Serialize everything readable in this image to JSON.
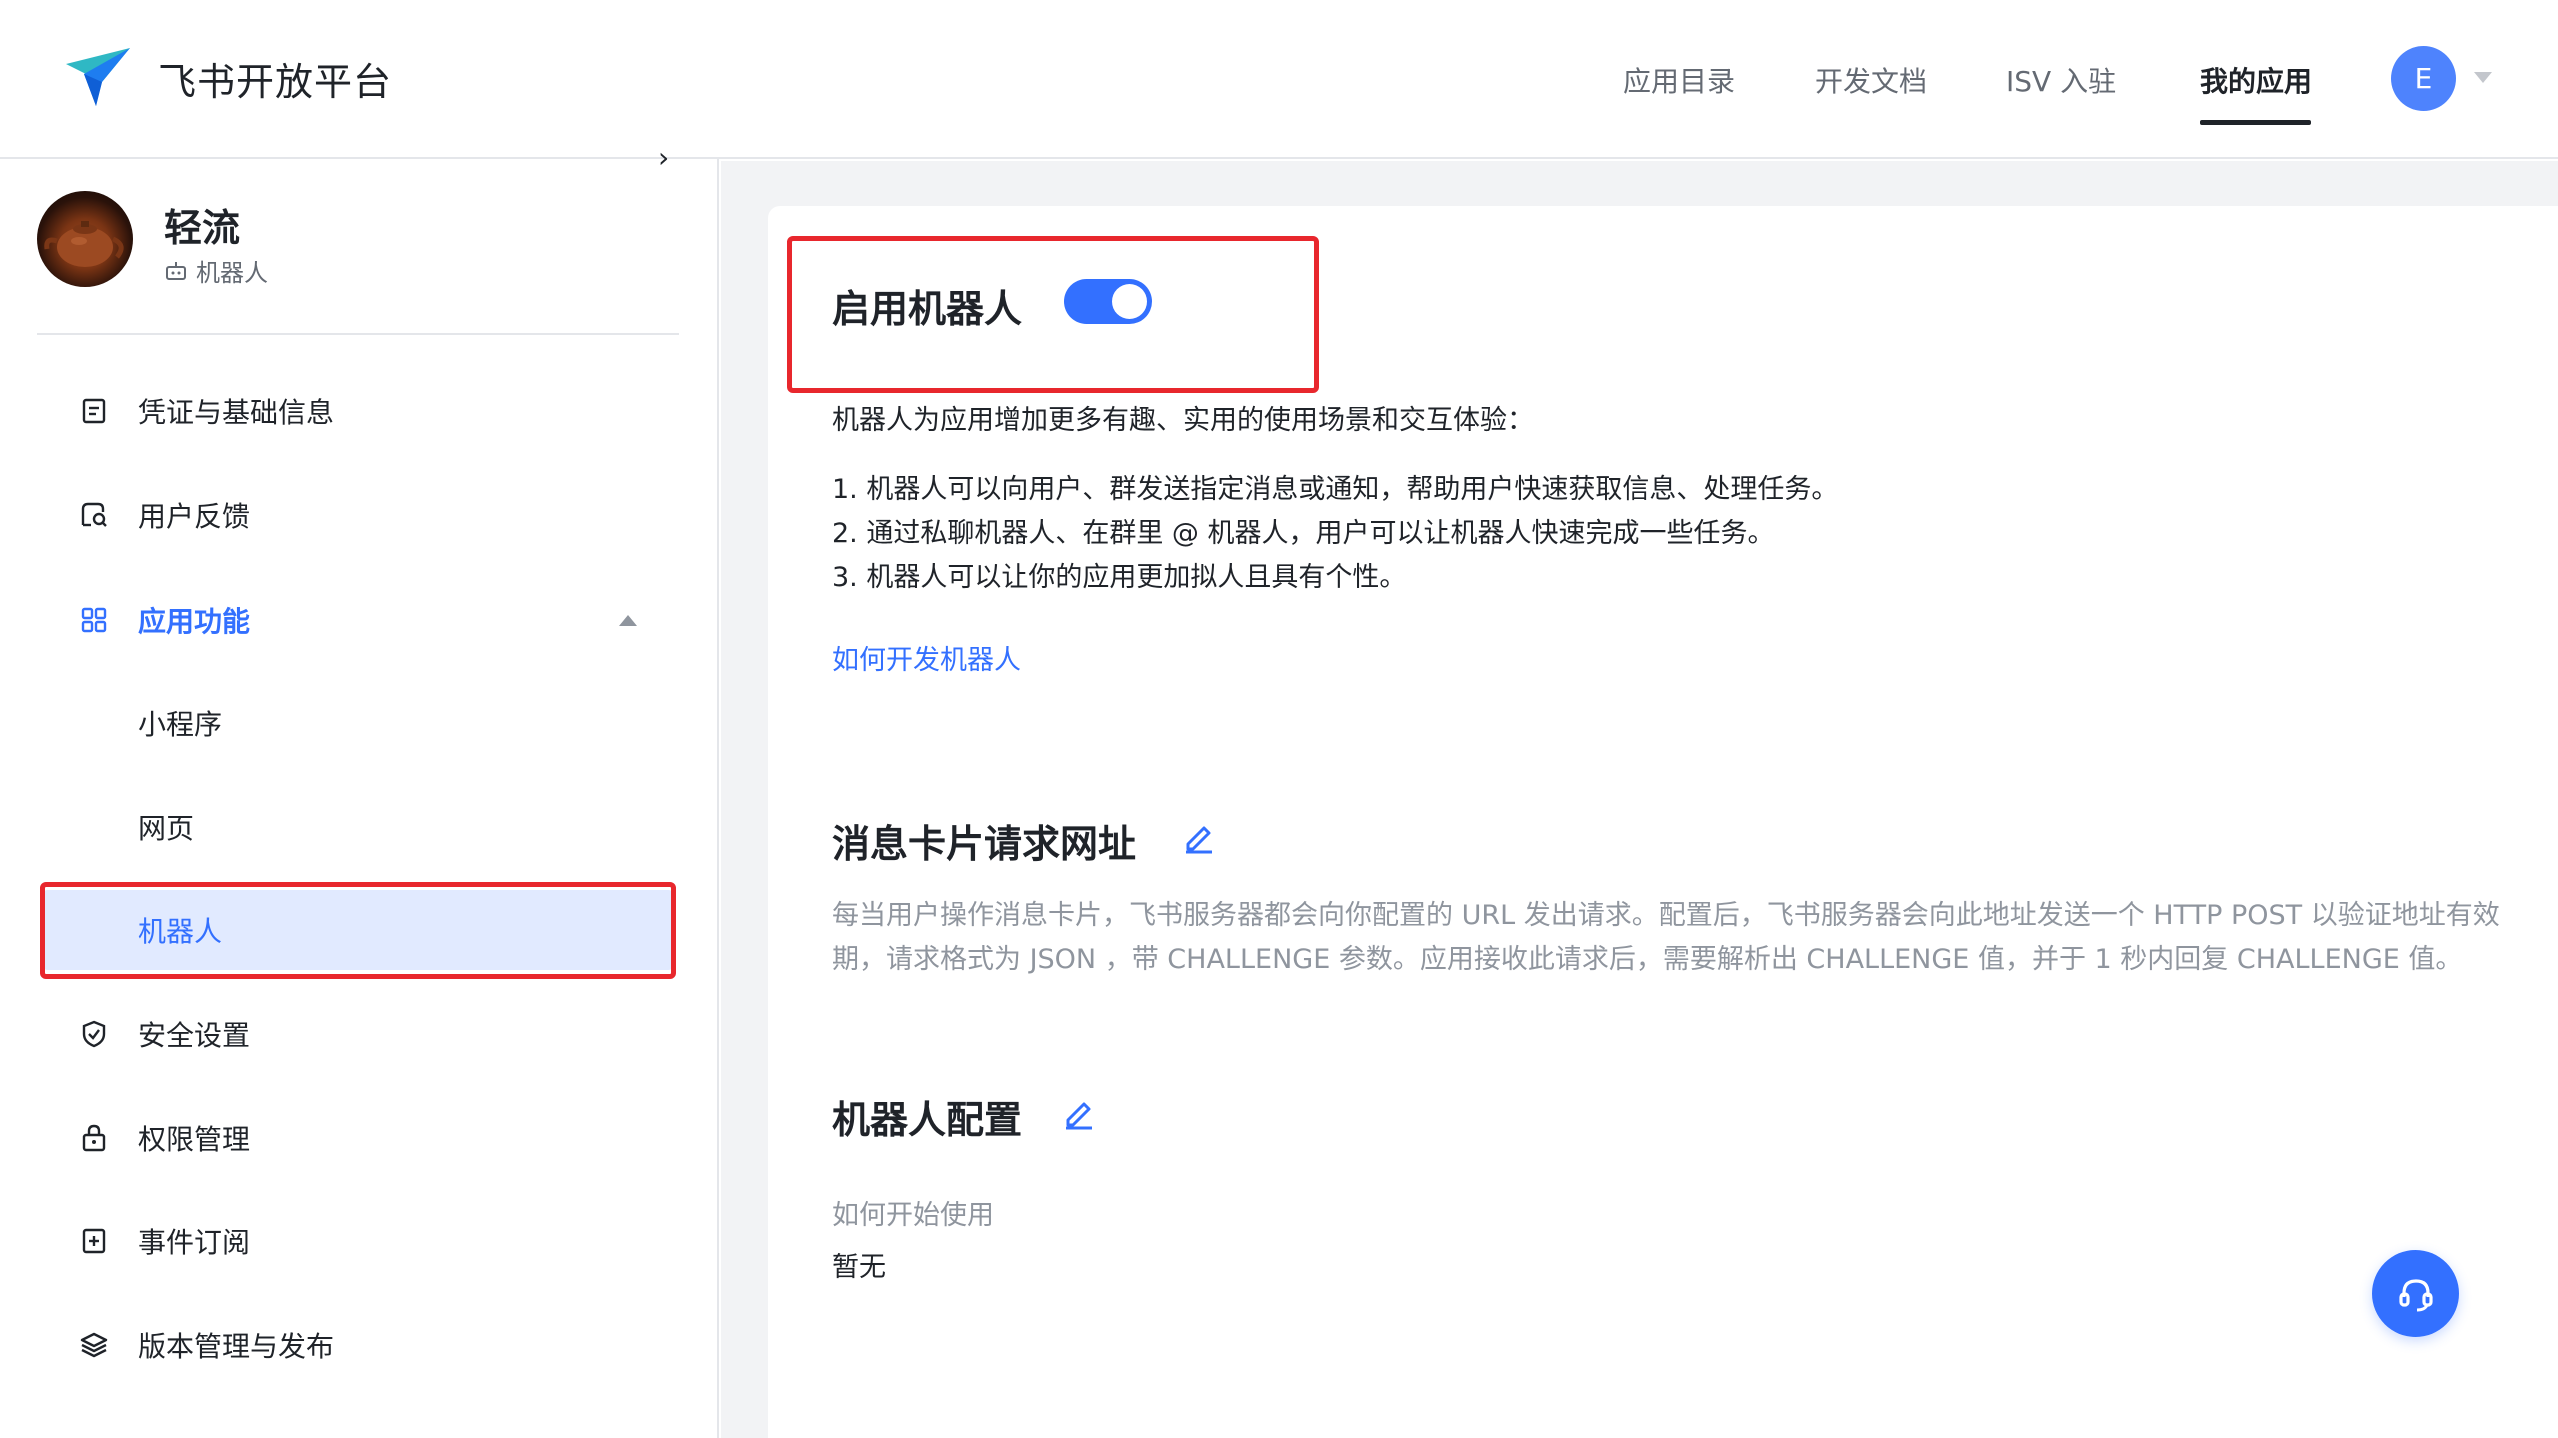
{
  "header": {
    "brand": "飞书开放平台",
    "nav": [
      {
        "label": "应用目录"
      },
      {
        "label": "开发文档"
      },
      {
        "label": "ISV 入驻"
      },
      {
        "label": "我的应用"
      }
    ],
    "avatar_letter": "E"
  },
  "sidebar": {
    "collapse_glyph": "›",
    "app_name": "轻流",
    "app_type": "机器人",
    "items": [
      {
        "label": "凭证与基础信息",
        "icon": "document-icon"
      },
      {
        "label": "用户反馈",
        "icon": "feedback-icon"
      },
      {
        "label": "应用功能",
        "icon": "grid-icon"
      },
      {
        "label": "小程序"
      },
      {
        "label": "网页"
      },
      {
        "label": "机器人"
      },
      {
        "label": "安全设置",
        "icon": "shield-icon"
      },
      {
        "label": "权限管理",
        "icon": "lock-icon"
      },
      {
        "label": "事件订阅",
        "icon": "subscribe-icon"
      },
      {
        "label": "版本管理与发布",
        "icon": "layers-icon"
      }
    ]
  },
  "main": {
    "bot_section": {
      "title": "启用机器人",
      "enabled": true,
      "intro": "机器人为应用增加更多有趣、实用的使用场景和交互体验：",
      "points": [
        "1. 机器人可以向用户、群发送指定消息或通知，帮助用户快速获取信息、处理任务。",
        "2. 通过私聊机器人、在群里 @ 机器人，用户可以让机器人快速完成一些任务。",
        "3. 机器人可以让你的应用更加拟人且具有个性。"
      ],
      "link": "如何开发机器人"
    },
    "card_url_section": {
      "title": "消息卡片请求网址",
      "desc_line1": "每当用户操作消息卡片，飞书服务器都会向你配置的 URL 发出请求。配置后，飞书服务器会向此地址发送一个 HTTP POST 以验证地址有效",
      "desc_line2": "期，请求格式为 JSON ，带 CHALLENGE 参数。应用接收此请求后，需要解析出 CHALLENGE 值，并于 1 秒内回复 CHALLENGE 值。"
    },
    "bot_config_section": {
      "title": "机器人配置",
      "how_to_label": "如何开始使用",
      "how_to_value": "暂无"
    }
  },
  "colors": {
    "accent": "#3370ff",
    "highlight_box": "#e8272d",
    "selected_bg": "#e1eaff"
  }
}
